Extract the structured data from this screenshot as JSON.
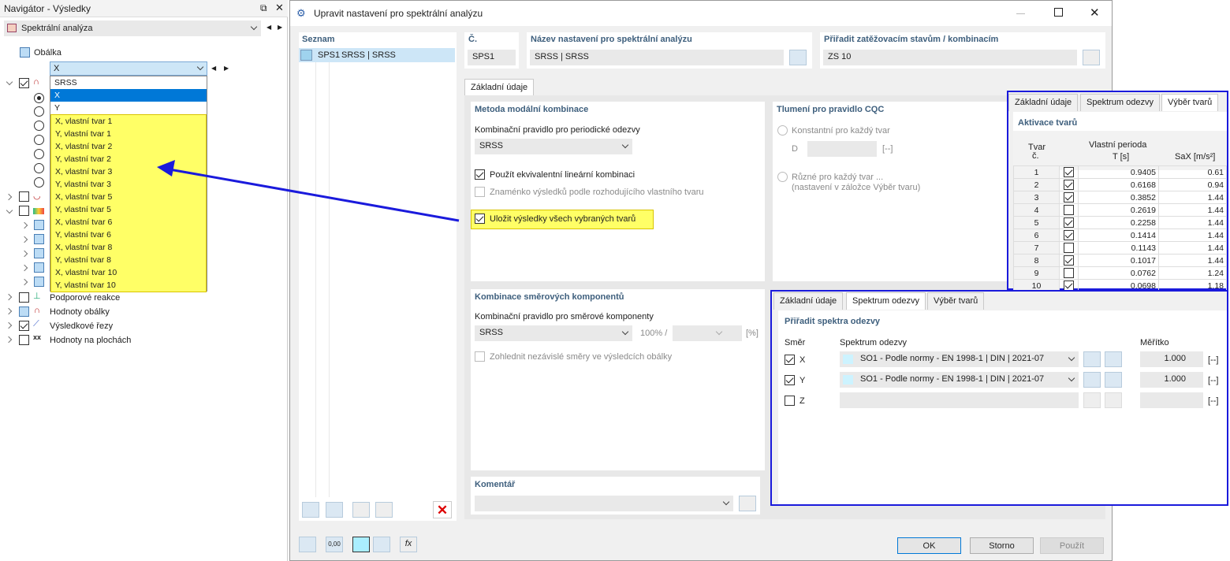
{
  "navigator": {
    "title": "Navigátor - Výsledky",
    "selector": "Spektrální analýza",
    "envelope": "Obálka",
    "combo_value": "X",
    "options": [
      "SRSS",
      "X",
      "Y"
    ],
    "mode_options": [
      "X, vlastní tvar 1",
      "Y, vlastní tvar 1",
      "X, vlastní tvar 2",
      "Y, vlastní tvar 2",
      "X, vlastní tvar 3",
      "Y, vlastní tvar 3",
      "X, vlastní tvar 5",
      "Y, vlastní tvar 5",
      "X, vlastní tvar 6",
      "Y, vlastní tvar 6",
      "X, vlastní tvar 8",
      "Y, vlastní tvar 8",
      "X, vlastní tvar 10",
      "Y, vlastní tvar 10"
    ],
    "tree": [
      "Podporové reakce",
      "Hodnoty obálky",
      "Výsledkové řezy",
      "Hodnoty na plochách"
    ]
  },
  "dialog": {
    "title": "Upravit nastavení pro spektrální analýzu",
    "list_header": "Seznam",
    "list_item_id": "SPS1",
    "list_item_name": "SRSS | SRSS",
    "no_label": "Č.",
    "no_value": "SPS1",
    "name_label": "Název nastavení pro spektrální analýzu",
    "name_value": "SRSS | SRSS",
    "assign_label": "Přiřadit zatěžovacím stavům / kombinacím",
    "assign_value": "ZS 10",
    "main_tab": "Základní údaje",
    "modal": {
      "title": "Metoda modální kombinace",
      "rule_label": "Kombinační pravidlo pro periodické odezvy",
      "rule_value": "SRSS",
      "opt1": "Použít ekvivalentní lineární kombinaci",
      "opt2": "Znaménko výsledků podle rozhodujícího vlastního tvaru",
      "opt3": "Uložit výsledky všech vybraných tvarů"
    },
    "damping": {
      "title": "Tlumení pro pravidlo CQC",
      "const": "Konstantní pro každý tvar",
      "d_label": "D",
      "unit": "[--]",
      "diff": "Různé pro každý tvar ...",
      "diff_note": "(nastavení v záložce Výběr tvaru)"
    },
    "direction": {
      "title": "Kombinace směrových komponentů",
      "rule_label": "Kombinační pravidlo pro směrové komponenty",
      "rule_value": "SRSS",
      "pct": "100% /",
      "pct_unit": "[%]",
      "opt": "Zohlednit nezávislé směry ve výsledcích obálky"
    },
    "comment_title": "Komentář",
    "ok": "OK",
    "cancel": "Storno",
    "apply": "Použít",
    "footer_value": "0,00"
  },
  "mode_panel": {
    "tabs": [
      "Základní údaje",
      "Spektrum odezvy",
      "Výběr tvarů"
    ],
    "title": "Aktivace tvarů",
    "col_mode": "Tvar",
    "col_mode2": "č.",
    "col_period": "Vlastní perioda",
    "col_period2": "T [s]",
    "col_sa": "SaX [m/s²]",
    "rows": [
      {
        "n": "1",
        "on": true,
        "t": "0.9405",
        "sa": "0.61"
      },
      {
        "n": "2",
        "on": true,
        "t": "0.6168",
        "sa": "0.94"
      },
      {
        "n": "3",
        "on": true,
        "t": "0.3852",
        "sa": "1.44"
      },
      {
        "n": "4",
        "on": false,
        "t": "0.2619",
        "sa": "1.44"
      },
      {
        "n": "5",
        "on": true,
        "t": "0.2258",
        "sa": "1.44"
      },
      {
        "n": "6",
        "on": true,
        "t": "0.1414",
        "sa": "1.44"
      },
      {
        "n": "7",
        "on": false,
        "t": "0.1143",
        "sa": "1.44"
      },
      {
        "n": "8",
        "on": true,
        "t": "0.1017",
        "sa": "1.44"
      },
      {
        "n": "9",
        "on": false,
        "t": "0.0762",
        "sa": "1.24"
      },
      {
        "n": "10",
        "on": true,
        "t": "0.0698",
        "sa": "1.18"
      }
    ]
  },
  "spectrum_panel": {
    "tabs": [
      "Základní údaje",
      "Spektrum odezvy",
      "Výběr tvarů"
    ],
    "title": "Přiřadit spektra odezvy",
    "col_dir": "Směr",
    "col_spec": "Spektrum odezvy",
    "col_scale": "Měřítko",
    "rows": [
      {
        "dir": "X",
        "on": true,
        "spec": "SO1 - Podle normy - EN 1998-1 | DIN | 2021-07",
        "scale": "1.000",
        "unit": "[--]"
      },
      {
        "dir": "Y",
        "on": true,
        "spec": "SO1 - Podle normy - EN 1998-1 | DIN | 2021-07",
        "scale": "1.000",
        "unit": "[--]"
      },
      {
        "dir": "Z",
        "on": false,
        "spec": "",
        "scale": "",
        "unit": "[--]"
      }
    ]
  },
  "colors": {
    "accent": "#1a1adc",
    "highlight": "#ffff66",
    "selection": "#0078d7"
  }
}
